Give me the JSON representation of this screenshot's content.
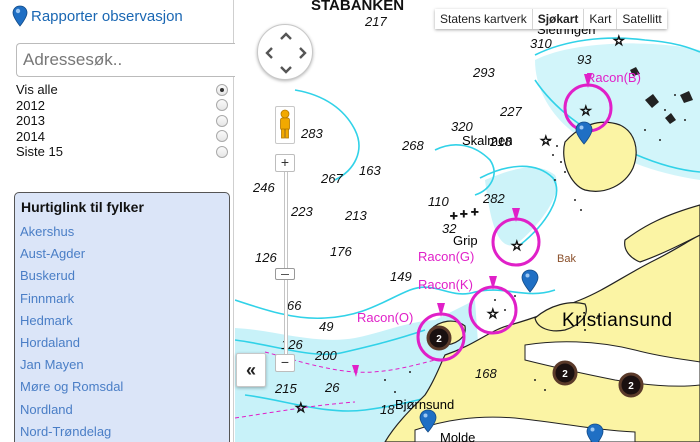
{
  "sidebar": {
    "report_link": "Rapporter observasjon",
    "search": {
      "placeholder": "Adressesøk..",
      "value": ""
    },
    "filters": [
      {
        "label": "Vis alle",
        "selected": true
      },
      {
        "label": "2012",
        "selected": false
      },
      {
        "label": "2013",
        "selected": false
      },
      {
        "label": "2014",
        "selected": false
      },
      {
        "label": "Siste 15",
        "selected": false
      }
    ],
    "counties": {
      "title": "Hurtiglink til fylker",
      "items": [
        "Akershus",
        "Aust-Agder",
        "Buskerud",
        "Finnmark",
        "Hedmark",
        "Hordaland",
        "Jan Mayen",
        "Møre og Romsdal",
        "Nordland",
        "Nord-Trøndelag"
      ]
    },
    "collapse_label": "«"
  },
  "map": {
    "map_types": [
      {
        "label": "Statens kartverk",
        "active": false
      },
      {
        "label": "Sjøkart",
        "active": true
      },
      {
        "label": "Kart",
        "active": false
      },
      {
        "label": "Satellitt",
        "active": false
      }
    ],
    "zoom_in": "+",
    "zoom_out": "−",
    "header_text": "STABANKEN",
    "place_names": {
      "sletringen": "Sletringen",
      "skalmen": "Skalmen",
      "grip": "Grip",
      "kristiansund": "Kristiansund",
      "bjornsund": "Bjørnsund",
      "bak": "Bak",
      "molde": "Molde"
    },
    "racon_labels": {
      "b": "Racon(B)",
      "g": "Racon(G)",
      "k": "Racon(K)",
      "o": "Racon(O)"
    },
    "cluster_counts": [
      "2",
      "2",
      "2"
    ],
    "depths": [
      "217",
      "310",
      "93",
      "293",
      "227",
      "218",
      "320",
      "268",
      "283",
      "246",
      "267",
      "163",
      "110",
      "282",
      "223",
      "213",
      "32",
      "176",
      "126",
      "149",
      "66",
      "49",
      "126",
      "200",
      "215",
      "26",
      "168",
      "18"
    ]
  },
  "colors": {
    "water_shallow": "#9be8f4",
    "contour": "#31d2e8",
    "land": "#fbf4a4",
    "racon": "#e020c8",
    "link": "#4a7ec6",
    "panel_bg": "#dbe5f8",
    "marker": "#1f6fc4"
  }
}
